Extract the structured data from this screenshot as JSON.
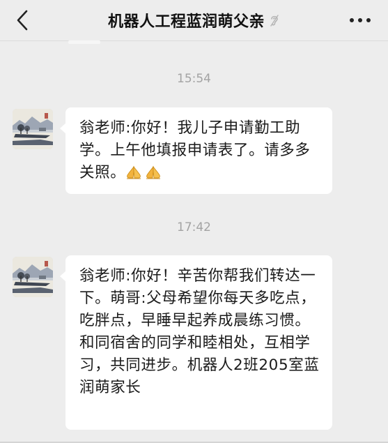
{
  "header": {
    "title": "机器人工程蓝润萌父亲",
    "back_icon": "chevron-left-icon",
    "mute_icon": "ear-mute-icon",
    "more_icon": "more-dots-icon"
  },
  "messages": [
    {
      "time": "15:54",
      "text": "翁老师:你好！我儿子申请勤工助学。上午他填报申请表了。请多多关照。",
      "emoji": [
        "folded-hands-icon",
        "folded-hands-icon"
      ]
    },
    {
      "time": "17:42",
      "text": "翁老师:你好！辛苦你帮我们转达一下。萌哥:父母希望你每天多吃点，吃胖点，早睡早起养成晨练习惯。和同宿舍的同学和睦相处，互相学习，共同进步。机器人2班205室蓝润萌家长"
    }
  ],
  "colors": {
    "background": "#ededed",
    "bubble": "#ffffff",
    "timestamp": "#a3a3a3"
  }
}
